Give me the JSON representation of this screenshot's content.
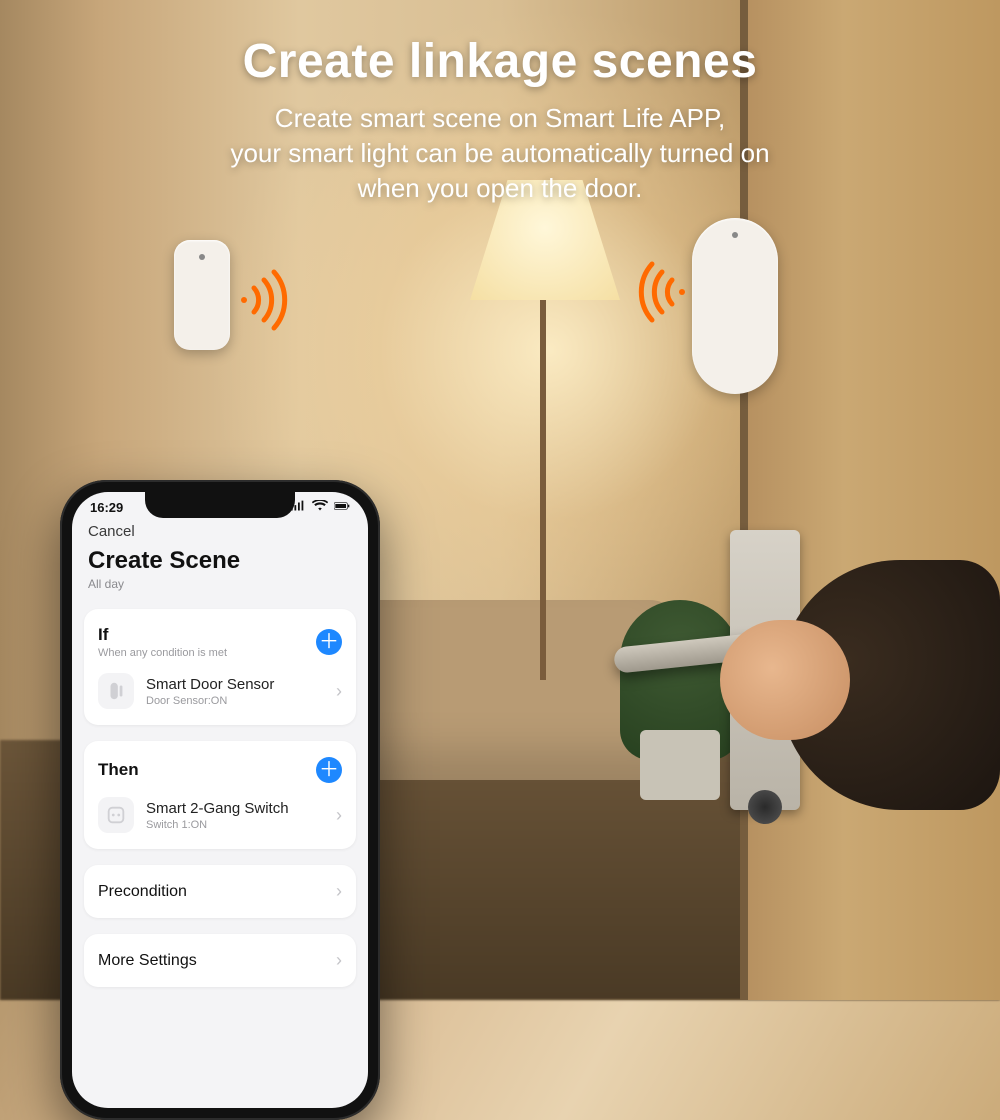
{
  "overlay": {
    "headline": "Create linkage scenes",
    "sub1": "Create smart scene on Smart Life APP,",
    "sub2": "your smart light can be automatically turned on",
    "sub3": "when you open the door."
  },
  "phone": {
    "status": {
      "time": "16:29"
    },
    "nav": {
      "cancel": "Cancel"
    },
    "title": "Create Scene",
    "subtitle": "All day",
    "if_section": {
      "label": "If",
      "hint": "When any condition is met",
      "item": {
        "name": "Smart Door Sensor",
        "detail": "Door Sensor:ON"
      }
    },
    "then_section": {
      "label": "Then",
      "item": {
        "name": "Smart 2-Gang Switch",
        "detail": "Switch 1:ON"
      }
    },
    "precondition": "Precondition",
    "more": "More Settings"
  }
}
